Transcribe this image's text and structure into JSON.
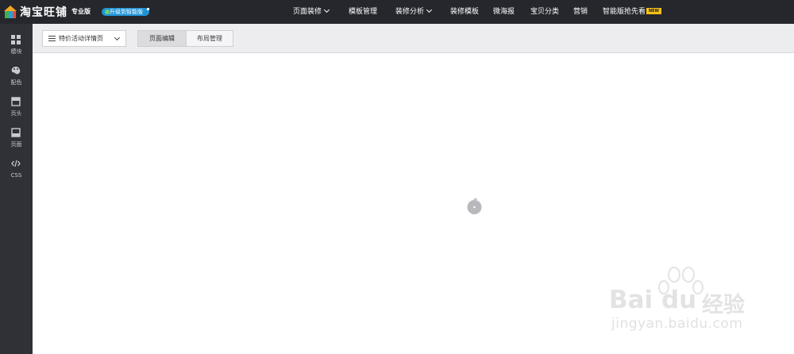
{
  "header": {
    "logo_text": "淘宝旺铺",
    "edition": "专业版",
    "upgrade_label": "升级到智能版",
    "nav": [
      {
        "label": "页面装修",
        "has_dropdown": true
      },
      {
        "label": "模板管理",
        "has_dropdown": false
      },
      {
        "label": "装修分析",
        "has_dropdown": true
      },
      {
        "label": "装修模板",
        "has_dropdown": false
      },
      {
        "label": "微海报",
        "has_dropdown": false
      },
      {
        "label": "宝贝分类",
        "has_dropdown": false
      },
      {
        "label": "营销",
        "has_dropdown": false
      },
      {
        "label": "智能版抢先看",
        "has_dropdown": false
      }
    ],
    "new_badge": "NEW"
  },
  "sidebar": {
    "items": [
      {
        "label": "模块",
        "icon": "grid-icon"
      },
      {
        "label": "配色",
        "icon": "palette-icon"
      },
      {
        "label": "页头",
        "icon": "page-header-icon"
      },
      {
        "label": "页面",
        "icon": "page-icon"
      },
      {
        "label": "CSS",
        "icon": "code-icon"
      }
    ]
  },
  "toolbar": {
    "page_selector": "特价活动详情页",
    "tabs": [
      {
        "label": "页面编辑",
        "active": true
      },
      {
        "label": "布局管理",
        "active": false
      }
    ]
  },
  "watermark": {
    "brand": "Bai du",
    "brand_cn": "经验",
    "url": "jingyan.baidu.com"
  },
  "colors": {
    "topbar_bg": "#25272d",
    "sidebar_bg": "#2f3137",
    "toolbar_bg": "#ededef",
    "upgrade_blue": "#1f93d6",
    "new_badge_yellow": "#f3c019"
  }
}
